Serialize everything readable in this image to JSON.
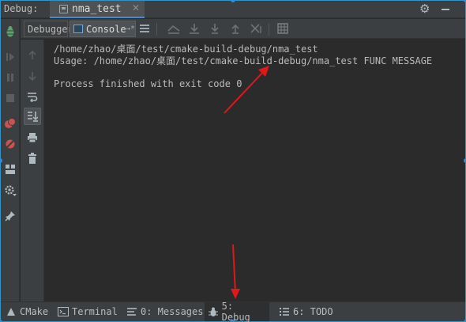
{
  "window": {
    "panel_label": "Debug:",
    "run_tab": "nma_test"
  },
  "debug_tabs": {
    "debugger": "Debugger",
    "console": "Console",
    "console_pin": "→*"
  },
  "console": {
    "lines": [
      "/home/zhao/桌面/test/cmake-build-debug/nma_test",
      "Usage: /home/zhao/桌面/test/cmake-build-debug/nma_test FUNC MESSAGE",
      "",
      "Process finished with exit code 0"
    ]
  },
  "bottom_bar": {
    "items": [
      {
        "label": "CMake",
        "icon": "cmake-icon"
      },
      {
        "label": "Terminal",
        "icon": "terminal-icon"
      },
      {
        "label": "0: Messages",
        "icon": "messages-icon"
      },
      {
        "label": "5: Debug",
        "icon": "bug-icon"
      },
      {
        "label": "6: TODO",
        "icon": "todo-icon"
      }
    ]
  },
  "colors": {
    "background": "#2b2b2b",
    "panel": "#3c3f41",
    "accent": "#3592c4",
    "annotation": "#e0171b"
  }
}
